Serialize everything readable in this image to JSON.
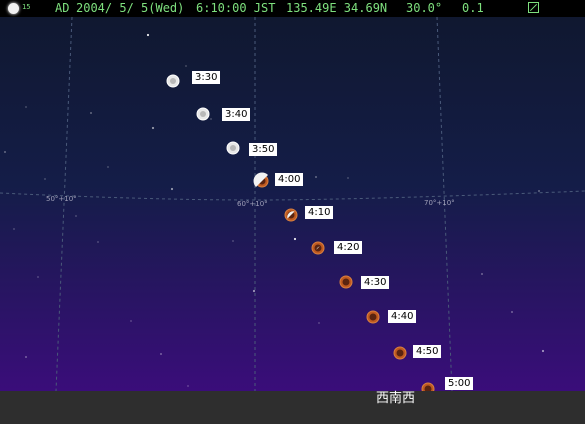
{
  "status": {
    "moon_age": "15",
    "era": "AD",
    "date": "2004/ 5/ 5(Wed)",
    "time": "6:10:00 JST",
    "location": "135.49E 34.69N",
    "field_of_view": "30.0°",
    "step": "0.1",
    "icons": [
      "moon-phase-icon",
      "grid-toggle-icon"
    ]
  },
  "sky": {
    "grid_labels": [
      "50°+10°",
      "60°+10°",
      "70°+10°"
    ],
    "moon_times": [
      "3:30",
      "3:40",
      "3:50",
      "4:00",
      "4:10",
      "4:20",
      "4:30",
      "4:40",
      "4:50",
      "5:00"
    ],
    "colors": {
      "sky_top": "#101830",
      "sky_bottom": "#3a0d7a",
      "grid": "#4a5a7a",
      "moon_full": "#e8e8e8",
      "moon_eclipsed": "#c05a20"
    }
  },
  "horizon": {
    "direction": "西南西"
  }
}
